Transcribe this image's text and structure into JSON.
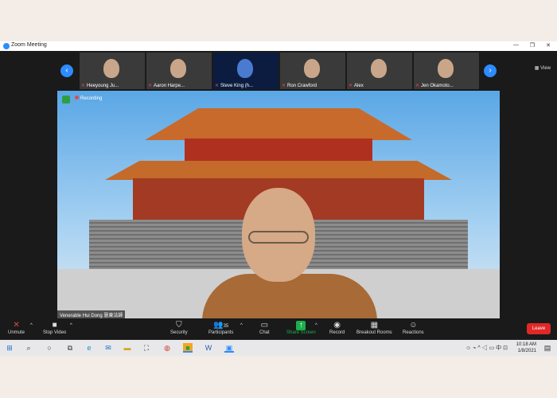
{
  "window": {
    "title": "Zoom Meeting"
  },
  "gallery": {
    "view_label": "View",
    "participants": [
      {
        "name": "Heeyoung Ju..."
      },
      {
        "name": "Aaron Harpe..."
      },
      {
        "name": "Steve King (h..."
      },
      {
        "name": "Ron Crawford"
      },
      {
        "name": "Alex"
      },
      {
        "name": "Jen Okamoto..."
      }
    ]
  },
  "main": {
    "recording_label": "Recording",
    "speaker_name": "Venerable Hui Dong 慧東法師"
  },
  "toolbar": {
    "unmute": "Unmute",
    "stop_video": "Stop Video",
    "security": "Security",
    "participants": "Participants",
    "participants_count": "35",
    "chat": "Chat",
    "share_screen": "Share Screen",
    "record": "Record",
    "breakout_rooms": "Breakout Rooms",
    "reactions": "Reactions",
    "leave": "Leave"
  },
  "taskbar": {
    "time": "10:18 AM",
    "date": "1/8/2021",
    "ime": "中"
  },
  "colors": {
    "zoom_blue": "#2d8cff",
    "share_green": "#1bae4b",
    "leave_red": "#e02828"
  }
}
